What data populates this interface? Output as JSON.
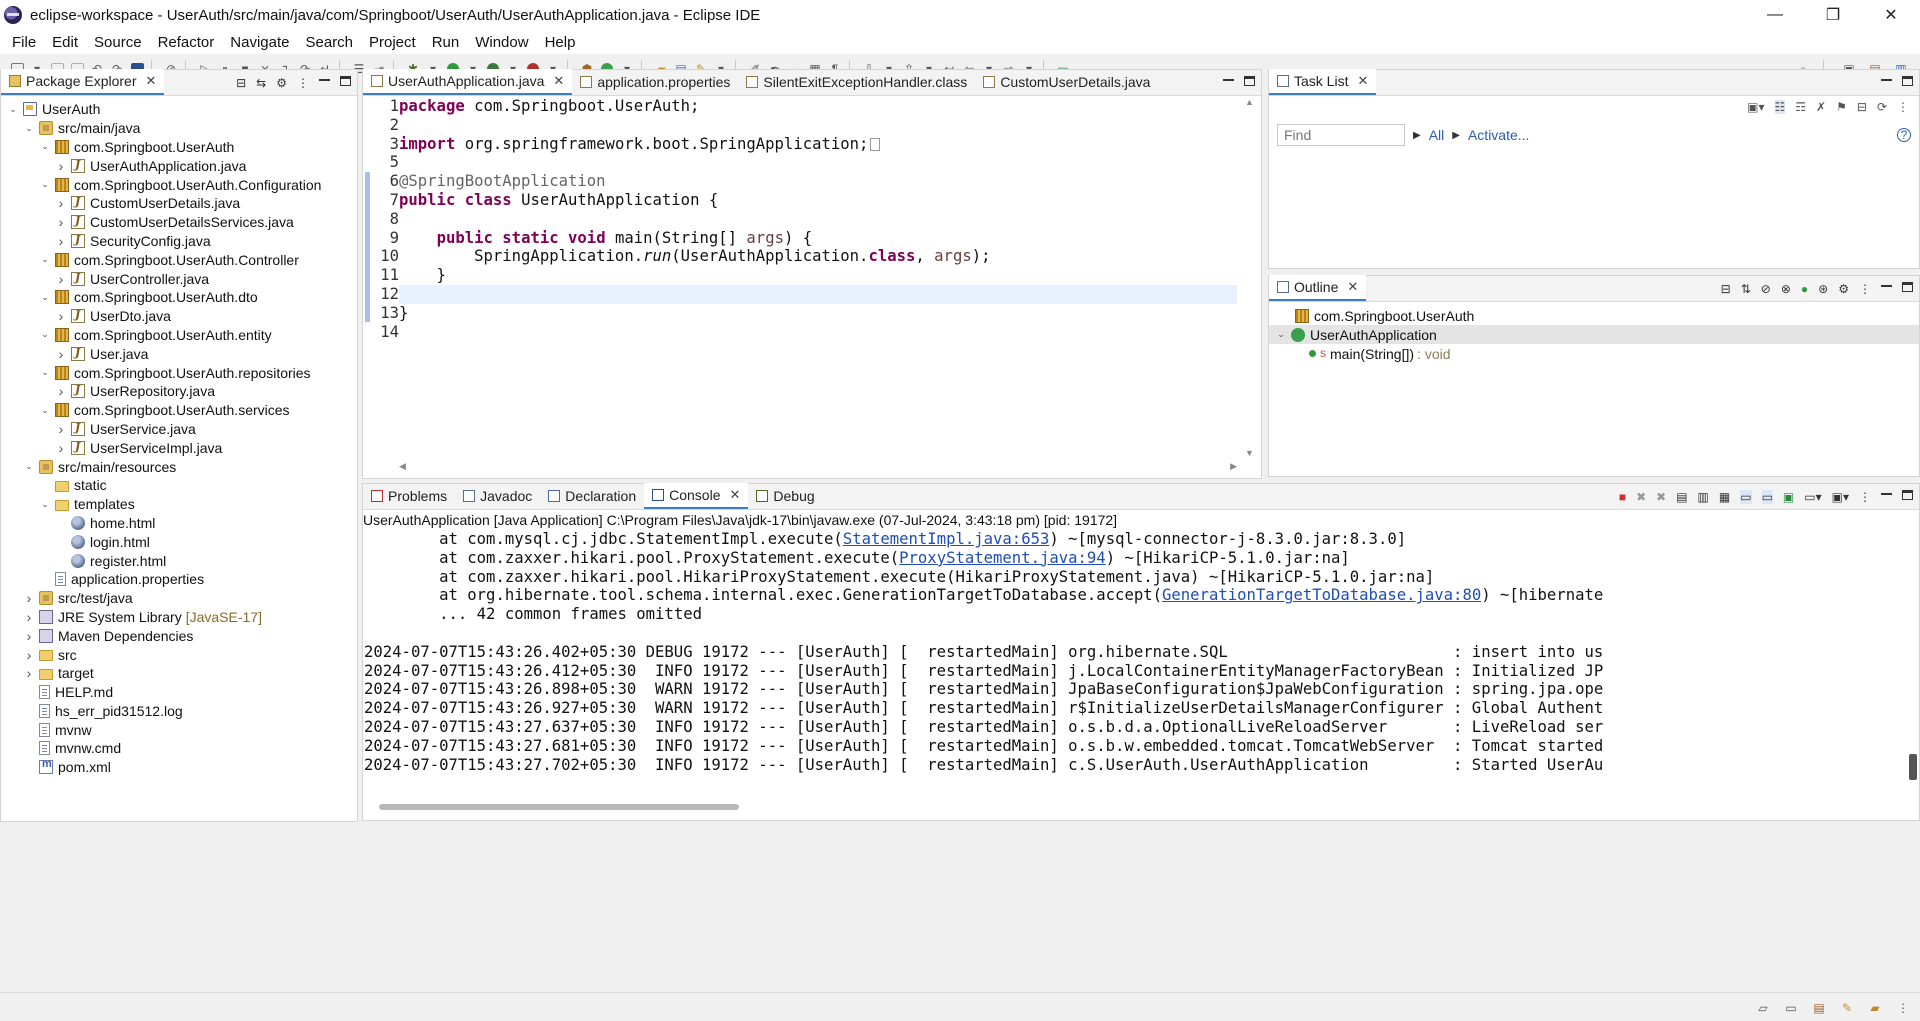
{
  "window": {
    "title": "eclipse-workspace - UserAuth/src/main/java/com/Springboot/UserAuth/UserAuthApplication.java - Eclipse IDE",
    "minimize": "—",
    "maximize": "❐",
    "close": "✕"
  },
  "menu": [
    "File",
    "Edit",
    "Source",
    "Refactor",
    "Navigate",
    "Search",
    "Project",
    "Run",
    "Window",
    "Help"
  ],
  "package_explorer": {
    "tab_label": "Package Explorer",
    "tree": [
      {
        "label": "UserAuth",
        "level": 0,
        "twisty": "open",
        "icon": "project"
      },
      {
        "label": "src/main/java",
        "level": 1,
        "twisty": "open",
        "icon": "srcfolder"
      },
      {
        "label": "com.Springboot.UserAuth",
        "level": 2,
        "twisty": "open",
        "icon": "package"
      },
      {
        "label": "UserAuthApplication.java",
        "level": 3,
        "twisty": "closed",
        "icon": "java"
      },
      {
        "label": "com.Springboot.UserAuth.Configuration",
        "level": 2,
        "twisty": "open",
        "icon": "package"
      },
      {
        "label": "CustomUserDetails.java",
        "level": 3,
        "twisty": "closed",
        "icon": "java"
      },
      {
        "label": "CustomUserDetailsServices.java",
        "level": 3,
        "twisty": "closed",
        "icon": "java"
      },
      {
        "label": "SecurityConfig.java",
        "level": 3,
        "twisty": "closed",
        "icon": "java"
      },
      {
        "label": "com.Springboot.UserAuth.Controller",
        "level": 2,
        "twisty": "open",
        "icon": "package"
      },
      {
        "label": "UserController.java",
        "level": 3,
        "twisty": "closed",
        "icon": "java"
      },
      {
        "label": "com.Springboot.UserAuth.dto",
        "level": 2,
        "twisty": "open",
        "icon": "package"
      },
      {
        "label": "UserDto.java",
        "level": 3,
        "twisty": "closed",
        "icon": "java"
      },
      {
        "label": "com.Springboot.UserAuth.entity",
        "level": 2,
        "twisty": "open",
        "icon": "package"
      },
      {
        "label": "User.java",
        "level": 3,
        "twisty": "closed",
        "icon": "java"
      },
      {
        "label": "com.Springboot.UserAuth.repositories",
        "level": 2,
        "twisty": "open",
        "icon": "package"
      },
      {
        "label": "UserRepository.java",
        "level": 3,
        "twisty": "closed",
        "icon": "java"
      },
      {
        "label": "com.Springboot.UserAuth.services",
        "level": 2,
        "twisty": "open",
        "icon": "package"
      },
      {
        "label": "UserService.java",
        "level": 3,
        "twisty": "closed",
        "icon": "java"
      },
      {
        "label": "UserServiceImpl.java",
        "level": 3,
        "twisty": "closed",
        "icon": "java"
      },
      {
        "label": "src/main/resources",
        "level": 1,
        "twisty": "open",
        "icon": "srcfolder"
      },
      {
        "label": "static",
        "level": 2,
        "twisty": "none",
        "icon": "folder"
      },
      {
        "label": "templates",
        "level": 2,
        "twisty": "open",
        "icon": "folder"
      },
      {
        "label": "home.html",
        "level": 3,
        "twisty": "none",
        "icon": "html"
      },
      {
        "label": "login.html",
        "level": 3,
        "twisty": "none",
        "icon": "html"
      },
      {
        "label": "register.html",
        "level": 3,
        "twisty": "none",
        "icon": "html"
      },
      {
        "label": "application.properties",
        "level": 2,
        "twisty": "none",
        "icon": "file"
      },
      {
        "label": "src/test/java",
        "level": 1,
        "twisty": "closed",
        "icon": "srcfolder"
      },
      {
        "label": "JRE System Library",
        "suffix": "[JavaSE-17]",
        "level": 1,
        "twisty": "closed",
        "icon": "lib"
      },
      {
        "label": "Maven Dependencies",
        "level": 1,
        "twisty": "closed",
        "icon": "lib"
      },
      {
        "label": "src",
        "level": 1,
        "twisty": "closed",
        "icon": "folder"
      },
      {
        "label": "target",
        "level": 1,
        "twisty": "closed",
        "icon": "folder"
      },
      {
        "label": "HELP.md",
        "level": 1,
        "twisty": "none",
        "icon": "file"
      },
      {
        "label": "hs_err_pid31512.log",
        "level": 1,
        "twisty": "none",
        "icon": "file"
      },
      {
        "label": "mvnw",
        "level": 1,
        "twisty": "none",
        "icon": "file"
      },
      {
        "label": "mvnw.cmd",
        "level": 1,
        "twisty": "none",
        "icon": "file"
      },
      {
        "label": "pom.xml",
        "level": 1,
        "twisty": "none",
        "icon": "xml"
      }
    ]
  },
  "editor": {
    "tabs": [
      {
        "label": "UserAuthApplication.java",
        "active": true,
        "closable": true
      },
      {
        "label": "application.properties",
        "active": false
      },
      {
        "label": "SilentExitExceptionHandler.class",
        "active": false
      },
      {
        "label": "CustomUserDetails.java",
        "active": false
      }
    ],
    "line_numbers": [
      "1",
      "2",
      "3",
      "5",
      "6",
      "7",
      "8",
      "9",
      "10",
      "11",
      "12",
      "13",
      "14"
    ],
    "current_line_index": 10
  },
  "task_list": {
    "tab_label": "Task List",
    "find_placeholder": "Find",
    "all_link": "All",
    "activate_link": "Activate..."
  },
  "outline": {
    "tab_label": "Outline",
    "package": "com.Springboot.UserAuth",
    "class_name": "UserAuthApplication",
    "method": "main(String[])",
    "method_return": ": void"
  },
  "console": {
    "tabs": [
      {
        "label": "Problems",
        "active": false
      },
      {
        "label": "Javadoc",
        "active": false
      },
      {
        "label": "Declaration",
        "active": false
      },
      {
        "label": "Console",
        "active": true
      },
      {
        "label": "Debug",
        "active": false
      }
    ],
    "header": "UserAuthApplication [Java Application] C:\\Program Files\\Java\\jdk-17\\bin\\javaw.exe  (07-Jul-2024, 3:43:18 pm) [pid: 19172]",
    "trace": [
      {
        "pre": "\tat com.mysql.cj.jdbc.StatementImpl.execute(",
        "link": "StatementImpl.java:653",
        "post": ") ~[mysql-connector-j-8.3.0.jar:8.3.0]"
      },
      {
        "pre": "\tat com.zaxxer.hikari.pool.ProxyStatement.execute(",
        "link": "ProxyStatement.java:94",
        "post": ") ~[HikariCP-5.1.0.jar:na]"
      },
      {
        "pre": "\tat com.zaxxer.hikari.pool.HikariProxyStatement.execute(HikariProxyStatement.java) ~[HikariCP-5.1.0.jar:na]",
        "link": "",
        "post": ""
      },
      {
        "pre": "\tat org.hibernate.tool.schema.internal.exec.GenerationTargetToDatabase.accept(",
        "link": "GenerationTargetToDatabase.java:80",
        "post": ") ~[hibernate"
      },
      {
        "pre": "\t... 42 common frames omitted",
        "link": "",
        "post": ""
      },
      {
        "pre": "",
        "link": "",
        "post": ""
      },
      {
        "pre": "2024-07-07T15:43:26.402+05:30 DEBUG 19172 --- [UserAuth] [  restartedMain] org.hibernate.SQL                        : insert into us",
        "link": "",
        "post": ""
      },
      {
        "pre": "2024-07-07T15:43:26.412+05:30  INFO 19172 --- [UserAuth] [  restartedMain] j.LocalContainerEntityManagerFactoryBean : Initialized JP",
        "link": "",
        "post": ""
      },
      {
        "pre": "2024-07-07T15:43:26.898+05:30  WARN 19172 --- [UserAuth] [  restartedMain] JpaBaseConfiguration$JpaWebConfiguration : spring.jpa.ope",
        "link": "",
        "post": ""
      },
      {
        "pre": "2024-07-07T15:43:26.927+05:30  WARN 19172 --- [UserAuth] [  restartedMain] r$InitializeUserDetailsManagerConfigurer : Global Authent",
        "link": "",
        "post": ""
      },
      {
        "pre": "2024-07-07T15:43:27.637+05:30  INFO 19172 --- [UserAuth] [  restartedMain] o.s.b.d.a.OptionalLiveReloadServer       : LiveReload ser",
        "link": "",
        "post": ""
      },
      {
        "pre": "2024-07-07T15:43:27.681+05:30  INFO 19172 --- [UserAuth] [  restartedMain] o.s.b.w.embedded.tomcat.TomcatWebServer  : Tomcat started",
        "link": "",
        "post": ""
      },
      {
        "pre": "2024-07-07T15:43:27.702+05:30  INFO 19172 --- [UserAuth] [  restartedMain] c.S.UserAuth.UserAuthApplication         : Started UserAu",
        "link": "",
        "post": ""
      }
    ]
  },
  "colors": {
    "keyword": "#7f0055",
    "annotation": "#646464",
    "link": "#1f4db5",
    "current_line": "#e8f2fe",
    "active_tab_border": "#3a7bd5"
  }
}
